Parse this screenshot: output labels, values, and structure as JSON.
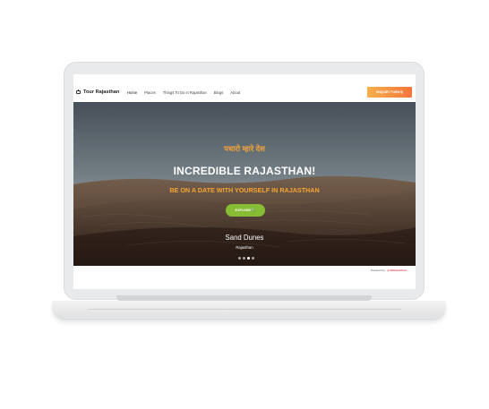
{
  "brand": {
    "name": "Tour Rajasthan",
    "icon": "camera-icon"
  },
  "nav": {
    "items": [
      {
        "label": "Home",
        "active": true
      },
      {
        "label": "Places",
        "active": false
      },
      {
        "label": "Things To Do in Rajasthan",
        "active": false
      },
      {
        "label": "Blogs",
        "active": false
      },
      {
        "label": "About",
        "active": false
      }
    ],
    "cta_label": "ENQUIRY FORM ⎘"
  },
  "hero": {
    "hindi_tagline": "पधारो म्हारे देस",
    "title": "INCREDIBLE RAJASTHAN!",
    "subtitle": "BE ON A DATE WITH YOURSELF IN RAJASTHAN",
    "button_label": "EXPLORE 🔍",
    "caption": "Sand Dunes",
    "location": "Rajasthan",
    "slide_count": 4,
    "active_slide": 3
  },
  "footer": {
    "powered_by": "Powered by",
    "powered_logo": "⊿⁄ Webwebhost"
  },
  "colors": {
    "accent_orange": "#f5a533",
    "button_green": "#86bd35",
    "cta_gradient_start": "#f6b04b",
    "cta_gradient_end": "#f5743b"
  }
}
